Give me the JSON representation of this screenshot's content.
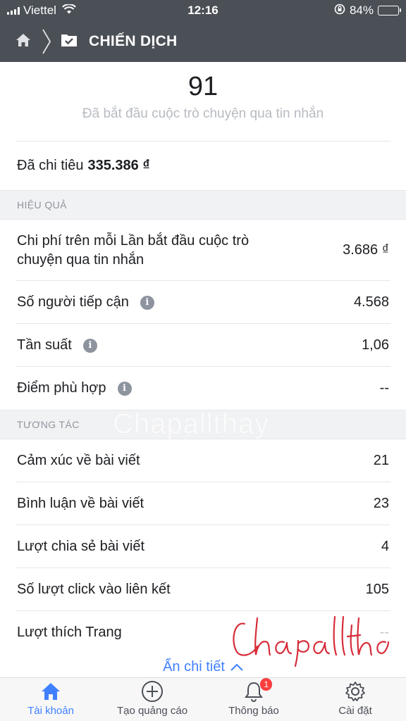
{
  "status_bar": {
    "carrier": "Viettel",
    "time": "12:16",
    "battery": "84%",
    "battery_level": 0.84
  },
  "header": {
    "title": "CHIẾN DỊCH"
  },
  "summary": {
    "count": "91",
    "caption": "Đã bắt đầu cuộc trò chuyện qua tin nhắn"
  },
  "spent": {
    "label": "Đã chi tiêu",
    "amount": "335.386 ₫"
  },
  "efficiency": {
    "heading": "HIỆU QUẢ",
    "rows": [
      {
        "label": "Chi phí trên mỗi Lần bắt đầu cuộc trò chuyện qua tin nhắn",
        "value": "3.686 ₫"
      },
      {
        "label": "Số người tiếp cận",
        "value": "4.568"
      },
      {
        "label": "Tần suất",
        "value": "1,06"
      },
      {
        "label": "Điểm phù hợp",
        "value": "--"
      }
    ]
  },
  "engagement": {
    "heading": "TƯƠNG TÁC",
    "rows": [
      {
        "label": "Cảm xúc về bài viết",
        "value": "21"
      },
      {
        "label": "Bình luận về bài viết",
        "value": "23"
      },
      {
        "label": "Lượt chia sẻ bài viết",
        "value": "4"
      },
      {
        "label": "Số lượt click vào liên kết",
        "value": "105"
      },
      {
        "label": "Lượt thích Trang",
        "value": "--"
      }
    ]
  },
  "hide_details": "Ẩn chi tiết",
  "watermark": "Chapallthay",
  "signature": "Chapallthay",
  "tabs": [
    {
      "label": "Tài khoản",
      "icon": "home-icon"
    },
    {
      "label": "Tạo quảng cáo",
      "icon": "plus-circle-icon"
    },
    {
      "label": "Thông báo",
      "icon": "bell-icon",
      "badge": "1"
    },
    {
      "label": "Cài đặt",
      "icon": "gear-icon"
    }
  ],
  "colors": {
    "header_bg": "#4b4f56",
    "accent": "#4080ff",
    "badge": "#fa3e3e",
    "section_bg": "#f1f2f4",
    "signature": "#d62d3a"
  }
}
